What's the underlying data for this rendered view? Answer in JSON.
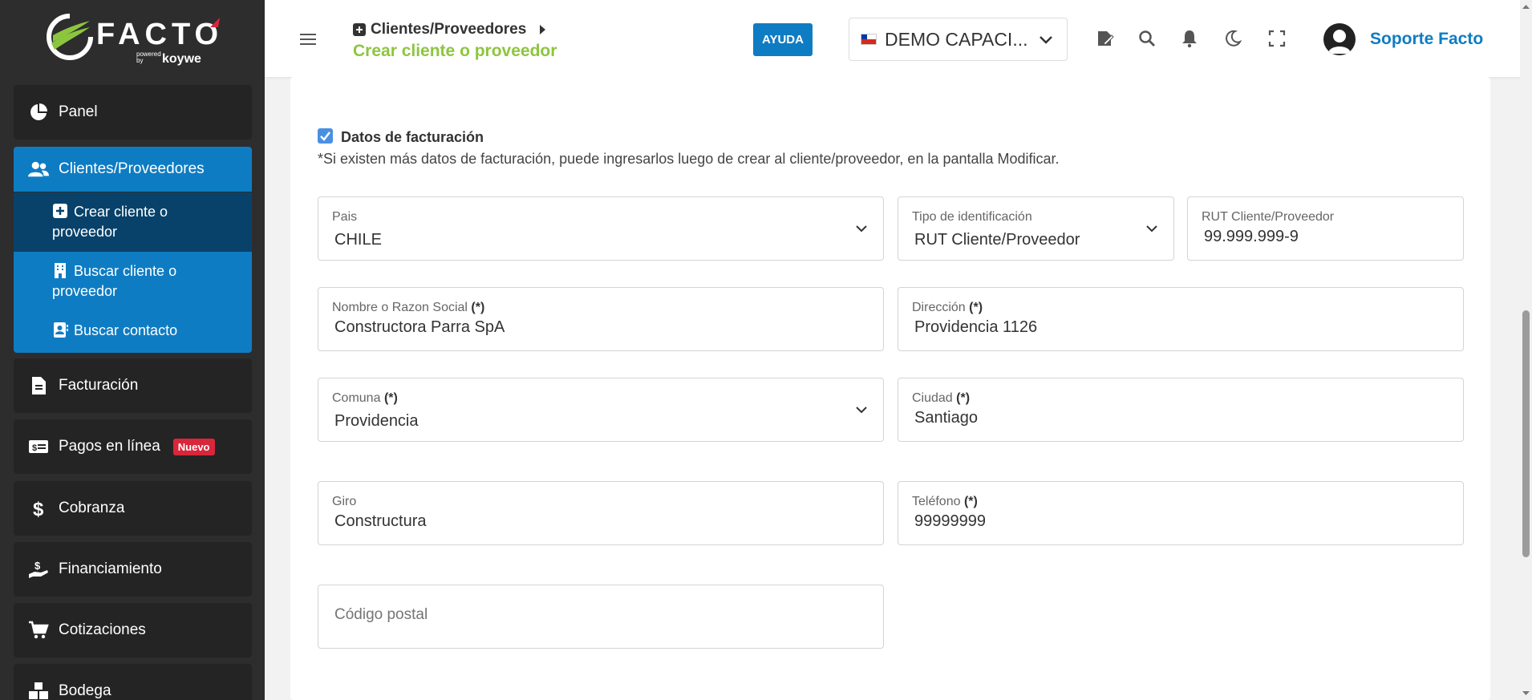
{
  "app": {
    "logo_text": "FACTO",
    "logo_powered": "powered by",
    "logo_brand": "koywe"
  },
  "sidebar": {
    "items": [
      {
        "label": "Panel"
      },
      {
        "label": "Clientes/Proveedores"
      },
      {
        "label": "Facturación"
      },
      {
        "label": "Pagos en línea",
        "badge": "Nuevo"
      },
      {
        "label": "Cobranza"
      },
      {
        "label": "Financiamiento"
      },
      {
        "label": "Cotizaciones"
      },
      {
        "label": "Bodega"
      }
    ],
    "sub_items": [
      {
        "label": "Crear cliente o proveedor"
      },
      {
        "label": "Buscar cliente o proveedor"
      },
      {
        "label": "Buscar contacto"
      }
    ]
  },
  "header": {
    "breadcrumb_parent": "Clientes/Proveedores",
    "breadcrumb_current": "Crear cliente o proveedor",
    "help_label": "AYUDA",
    "company": "DEMO CAPACI...",
    "user_name": "Soporte Facto"
  },
  "form": {
    "billing_checkbox_label": "Datos de facturación",
    "billing_note": "*Si existen más datos de facturación, puede ingresarlos luego de crear al cliente/proveedor, en la pantalla Modificar.",
    "required_mark": "(*)",
    "pais": {
      "label": "Pais",
      "value": "CHILE"
    },
    "tipo_id": {
      "label": "Tipo de identificación",
      "value": "RUT Cliente/Proveedor"
    },
    "rut": {
      "label": "RUT Cliente/Proveedor",
      "value": "99.999.999-9"
    },
    "nombre": {
      "label": "Nombre o Razon Social",
      "value": "Constructora Parra SpA"
    },
    "direccion": {
      "label": "Dirección",
      "value": "Providencia 1126"
    },
    "comuna": {
      "label": "Comuna",
      "value": "Providencia"
    },
    "ciudad": {
      "label": "Ciudad",
      "value": "Santiago"
    },
    "giro": {
      "label": "Giro",
      "value": "Constructura"
    },
    "telefono": {
      "label": "Teléfono",
      "value": "99999999"
    },
    "codigo_postal": {
      "placeholder": "Código postal"
    }
  },
  "colors": {
    "accent_blue": "#0e7cc3",
    "accent_green": "#8cc63e",
    "sidebar_bg": "#2d2d2e",
    "badge_red": "#d9263a"
  }
}
